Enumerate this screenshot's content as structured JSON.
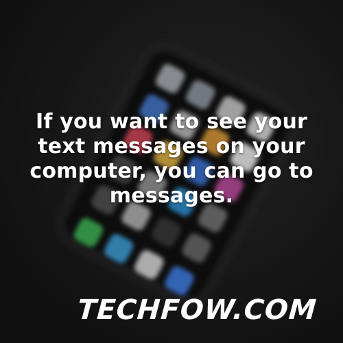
{
  "caption": {
    "line1": "If you want to see your",
    "line2": "text messages on your",
    "line3": "computer, you can go to",
    "line4": "messages."
  },
  "watermark": {
    "text": "TECHFOW.COM"
  },
  "colors": {
    "background": "#1b1b1b",
    "text": "#ffffff"
  },
  "icons": [
    "smartphone-icon",
    "app-icon"
  ]
}
